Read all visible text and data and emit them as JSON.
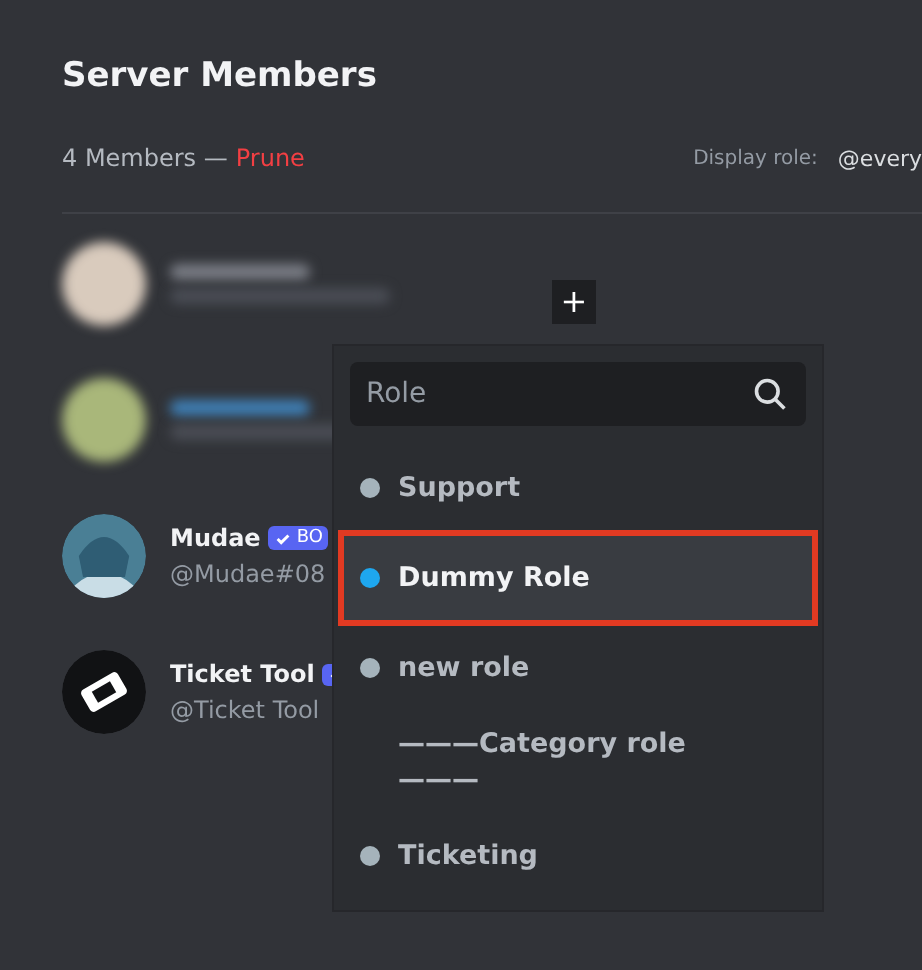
{
  "header": {
    "title": "Server Members",
    "member_count": "4 Members —",
    "prune_link": "Prune",
    "display_role_label": "Display role:",
    "display_role_value": "@every"
  },
  "members": [
    {
      "kind": "blurred",
      "color": "#d9cbbd"
    },
    {
      "kind": "blurred",
      "color": "#a9b77a"
    },
    {
      "kind": "member",
      "name": "Mudae",
      "bot_badge": true,
      "badge": "BO",
      "tag": "@Mudae#08",
      "avatar": {
        "kind": "anime"
      }
    },
    {
      "kind": "member",
      "name": "Ticket Tool",
      "bot_badge": true,
      "tag": "@Ticket Tool",
      "avatar": {
        "kind": "ticket"
      }
    }
  ],
  "add_role_button": "+",
  "role_menu": {
    "search": {
      "placeholder": "Role"
    },
    "roles": [
      {
        "label": "Support",
        "color": "#a5b3bb",
        "selected": false
      },
      {
        "label": "Dummy Role",
        "color": "#1ea7ef",
        "selected": true
      },
      {
        "label": "new role",
        "color": "#a5b3bb",
        "selected": false
      },
      {
        "label": "———Category role———",
        "selected": false
      },
      {
        "label": "Ticketing",
        "color": "#a5b3bb",
        "selected": false
      }
    ]
  }
}
